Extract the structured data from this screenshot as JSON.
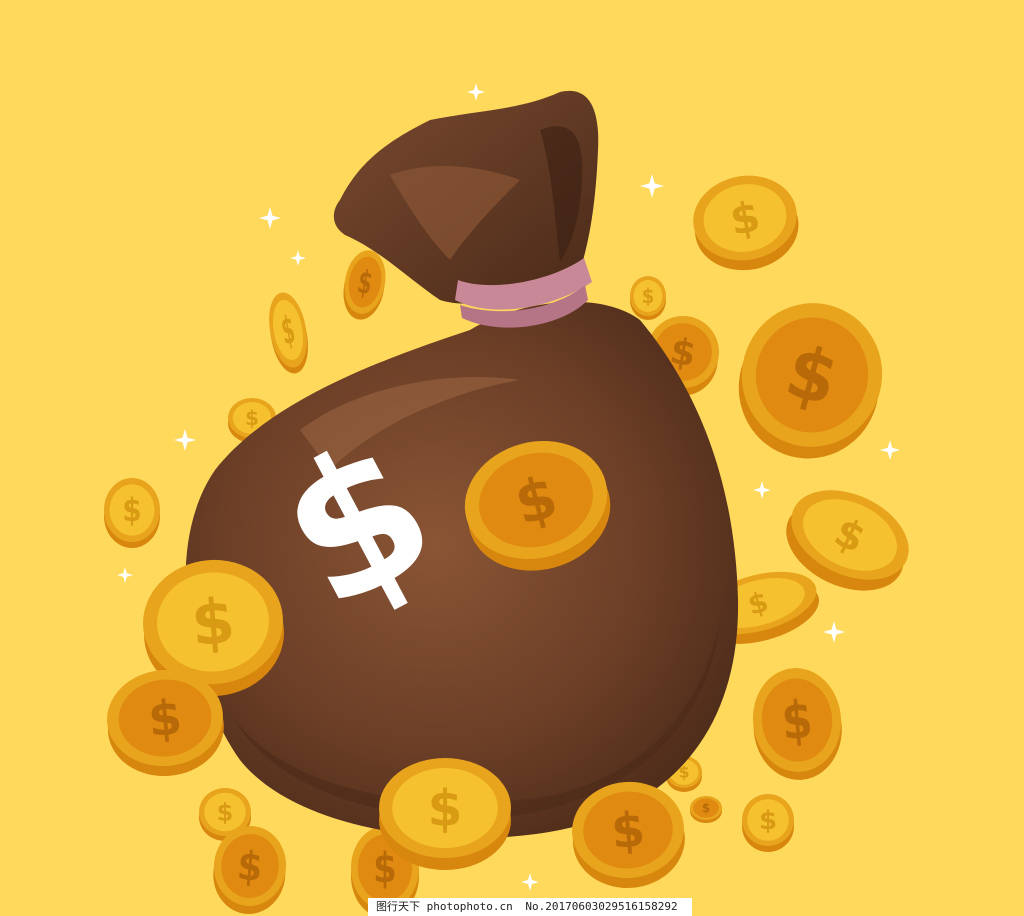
{
  "scene": {
    "subject": "money-bag-with-gold-coins",
    "bag_symbol": "$",
    "coin_symbol": "$"
  },
  "colors": {
    "background": "#FFD95C",
    "bag_body": "#6B3E26",
    "bag_shadow": "#4A2A18",
    "bag_highlight": "#8A5535",
    "bag_top": "#5A3420",
    "bag_top_highlight": "#7A4A30",
    "rope": "#C98898",
    "coin_face": "#F6C12F",
    "coin_rim": "#E8A41C",
    "coin_edge": "#D7860E",
    "coin_dark": "#E08A12",
    "sparkle": "#FFFFFF"
  },
  "watermark": {
    "site": "图行天下 photophoto.cn",
    "number": "No.20170603029516158292"
  }
}
